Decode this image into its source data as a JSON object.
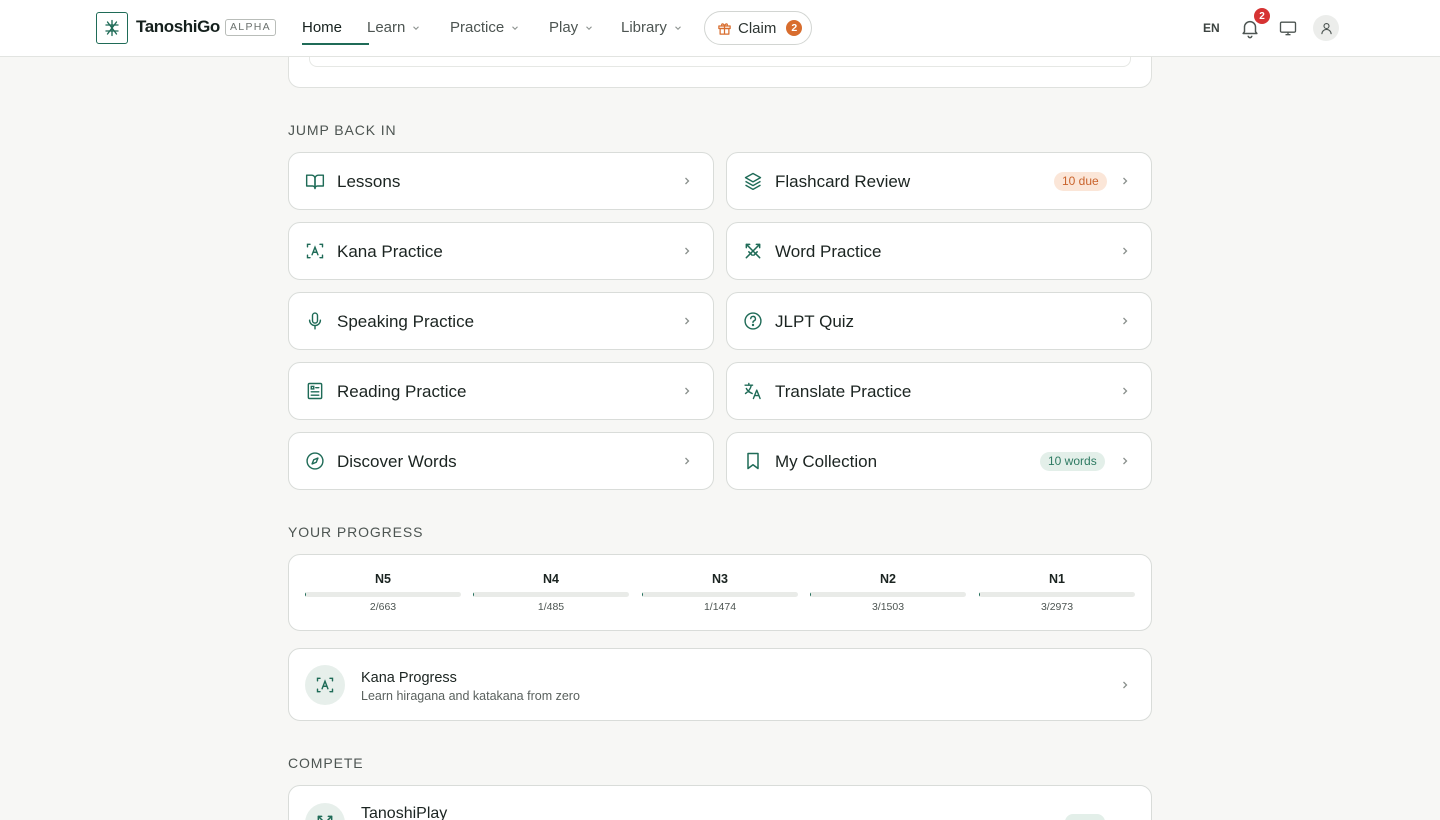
{
  "header": {
    "brand": "TanoshiGo",
    "badge": "ALPHA",
    "nav": [
      {
        "label": "Home"
      },
      {
        "label": "Learn"
      },
      {
        "label": "Practice"
      },
      {
        "label": "Play"
      },
      {
        "label": "Library"
      }
    ],
    "claim": {
      "label": "Claim",
      "count": "2"
    },
    "language": "EN",
    "notifications_count": "2"
  },
  "jump_back_in": {
    "title": "JUMP BACK IN",
    "items": [
      {
        "label": "Lessons",
        "icon": "book-open-icon"
      },
      {
        "label": "Flashcard Review",
        "icon": "layers-icon",
        "badge": "10 due"
      },
      {
        "label": "Kana Practice",
        "icon": "scan-text-icon"
      },
      {
        "label": "Word Practice",
        "icon": "crossed-swords-icon"
      },
      {
        "label": "Speaking Practice",
        "icon": "microphone-icon"
      },
      {
        "label": "JLPT Quiz",
        "icon": "help-circle-icon"
      },
      {
        "label": "Reading Practice",
        "icon": "document-list-icon"
      },
      {
        "label": "Translate Practice",
        "icon": "translate-icon"
      },
      {
        "label": "Discover Words",
        "icon": "compass-icon"
      },
      {
        "label": "My Collection",
        "icon": "bookmark-icon",
        "badge": "10 words"
      }
    ]
  },
  "progress": {
    "title": "YOUR PROGRESS",
    "levels": [
      {
        "name": "N5",
        "count": "2/663"
      },
      {
        "name": "N4",
        "count": "1/485"
      },
      {
        "name": "N3",
        "count": "1/1474"
      },
      {
        "name": "N2",
        "count": "3/1503"
      },
      {
        "name": "N1",
        "count": "3/2973"
      }
    ]
  },
  "kana_progress": {
    "title": "Kana Progress",
    "subtitle": "Learn hiragana and katakana from zero"
  },
  "compete": {
    "title": "COMPETE",
    "item_title": "TanoshiPlay"
  },
  "colors": {
    "accent": "#1f6b57",
    "claim": "#d86d2e",
    "alert": "#d63333"
  }
}
